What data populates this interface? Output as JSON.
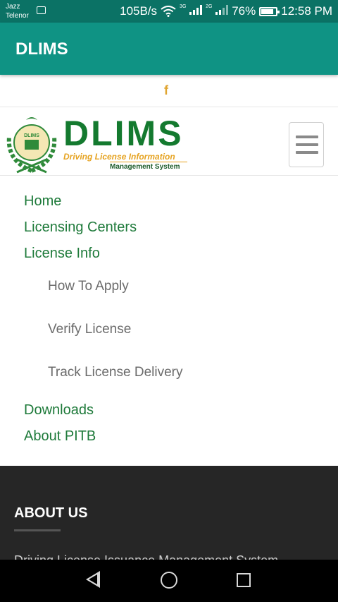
{
  "status_bar": {
    "carrier_1": "Jazz",
    "carrier_2": "Telenor",
    "speed": "105B/s",
    "network_1": "3G",
    "network_2": "2G",
    "battery": "76%",
    "time": "12:58 PM"
  },
  "app_bar": {
    "title": "DLIMS"
  },
  "social": {
    "facebook_glyph": "f"
  },
  "logo": {
    "emblem_text": "DLIMS",
    "main": "DLIMS",
    "sub_line_1": "Driving License Information",
    "sub_line_2": "Management System"
  },
  "nav": {
    "items": [
      {
        "label": "Home"
      },
      {
        "label": "Licensing Centers"
      },
      {
        "label": "License Info"
      },
      {
        "label": "How To Apply"
      },
      {
        "label": "Verify License"
      },
      {
        "label": "Track License Delivery"
      },
      {
        "label": "Downloads"
      },
      {
        "label": "About PITB"
      }
    ]
  },
  "footer": {
    "title": "ABOUT US",
    "text": "Driving License Issuance Management System"
  },
  "colors": {
    "status_bar": "#0b7265",
    "app_bar": "#0f9384",
    "nav_link": "#1e7a3a",
    "sub_link": "#6b6b6b",
    "accent": "#e0a531",
    "footer_bg": "#262626"
  }
}
